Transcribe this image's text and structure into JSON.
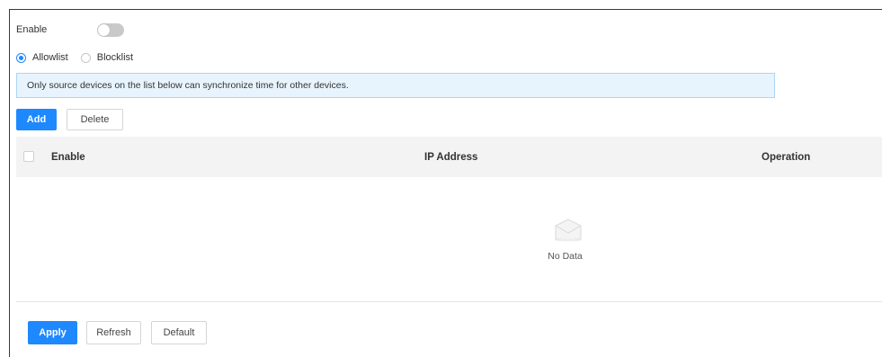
{
  "enable": {
    "label": "Enable",
    "toggle_on": false
  },
  "mode": {
    "options": [
      {
        "label": "Allowlist",
        "selected": true
      },
      {
        "label": "Blocklist",
        "selected": false
      }
    ]
  },
  "notice": {
    "text": "Only source devices on the list below can synchronize time for other devices."
  },
  "toolbar": {
    "add_label": "Add",
    "delete_label": "Delete"
  },
  "table": {
    "columns": [
      "Enable",
      "IP Address",
      "Operation"
    ],
    "rows": [],
    "empty_text": "No Data"
  },
  "footer": {
    "apply_label": "Apply",
    "refresh_label": "Refresh",
    "default_label": "Default"
  },
  "colors": {
    "accent": "#1e88ff",
    "notice_bg": "#e8f4fd",
    "notice_border": "#a9d6f5"
  }
}
